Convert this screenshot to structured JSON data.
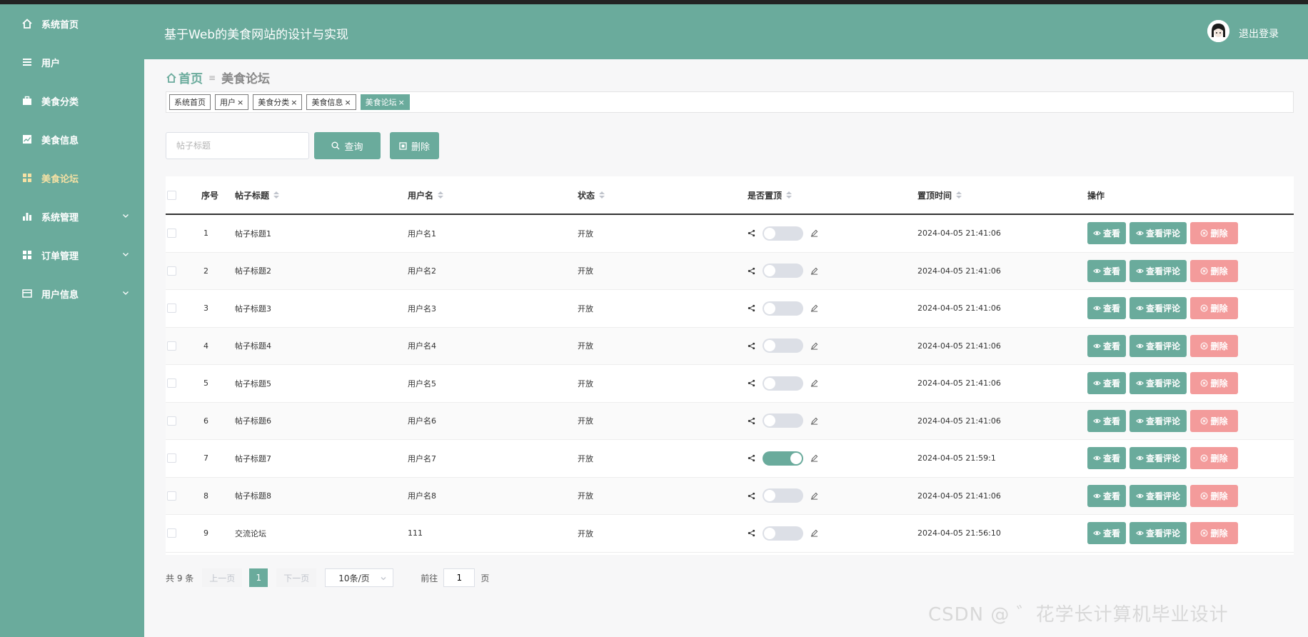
{
  "app_title": "基于Web的美食网站的设计与实现",
  "header": {
    "logout": "退出登录"
  },
  "sidebar": {
    "items": [
      {
        "label": "系统首页",
        "icon": "home-icon",
        "active": false,
        "expandable": false
      },
      {
        "label": "用户",
        "icon": "list-icon",
        "active": false,
        "expandable": false
      },
      {
        "label": "美食分类",
        "icon": "briefcase-icon",
        "active": false,
        "expandable": false
      },
      {
        "label": "美食信息",
        "icon": "chart-icon",
        "active": false,
        "expandable": false
      },
      {
        "label": "美食论坛",
        "icon": "grid-icon",
        "active": true,
        "expandable": false
      },
      {
        "label": "系统管理",
        "icon": "bar-chart-icon",
        "active": false,
        "expandable": true
      },
      {
        "label": "订单管理",
        "icon": "grid-icon",
        "active": false,
        "expandable": true
      },
      {
        "label": "用户信息",
        "icon": "card-icon",
        "active": false,
        "expandable": true
      }
    ]
  },
  "breadcrumb": {
    "home": "首页",
    "current": "美食论坛"
  },
  "tags": [
    {
      "label": "系统首页",
      "closable": false,
      "active": false
    },
    {
      "label": "用户",
      "closable": true,
      "active": false
    },
    {
      "label": "美食分类",
      "closable": true,
      "active": false
    },
    {
      "label": "美食信息",
      "closable": true,
      "active": false
    },
    {
      "label": "美食论坛",
      "closable": true,
      "active": true
    }
  ],
  "search": {
    "placeholder": "帖子标题",
    "value": "",
    "query_label": "查询",
    "delete_label": "删除"
  },
  "table": {
    "columns": {
      "index": "序号",
      "title": "帖子标题",
      "username": "用户名",
      "status": "状态",
      "pinned": "是否置顶",
      "pin_time": "置顶时间",
      "actions": "操作"
    },
    "actions": {
      "view": "查看",
      "comments": "查看评论",
      "delete": "删除"
    },
    "rows": [
      {
        "index": "1",
        "title": "帖子标题1",
        "username": "用户名1",
        "status": "开放",
        "pinned": false,
        "pin_time": "2024-04-05 21:41:06"
      },
      {
        "index": "2",
        "title": "帖子标题2",
        "username": "用户名2",
        "status": "开放",
        "pinned": false,
        "pin_time": "2024-04-05 21:41:06"
      },
      {
        "index": "3",
        "title": "帖子标题3",
        "username": "用户名3",
        "status": "开放",
        "pinned": false,
        "pin_time": "2024-04-05 21:41:06"
      },
      {
        "index": "4",
        "title": "帖子标题4",
        "username": "用户名4",
        "status": "开放",
        "pinned": false,
        "pin_time": "2024-04-05 21:41:06"
      },
      {
        "index": "5",
        "title": "帖子标题5",
        "username": "用户名5",
        "status": "开放",
        "pinned": false,
        "pin_time": "2024-04-05 21:41:06"
      },
      {
        "index": "6",
        "title": "帖子标题6",
        "username": "用户名6",
        "status": "开放",
        "pinned": false,
        "pin_time": "2024-04-05 21:41:06"
      },
      {
        "index": "7",
        "title": "帖子标题7",
        "username": "用户名7",
        "status": "开放",
        "pinned": true,
        "pin_time": "2024-04-05 21:59:1"
      },
      {
        "index": "8",
        "title": "帖子标题8",
        "username": "用户名8",
        "status": "开放",
        "pinned": false,
        "pin_time": "2024-04-05 21:41:06"
      },
      {
        "index": "9",
        "title": "交流论坛",
        "username": "111",
        "status": "开放",
        "pinned": false,
        "pin_time": "2024-04-05 21:56:10"
      }
    ]
  },
  "pagination": {
    "total": "共 9 条",
    "prev": "上一页",
    "page": "1",
    "next": "下一页",
    "page_size": "10条/页",
    "goto_label": "前往",
    "goto_value": "1",
    "page_unit": "页"
  },
  "watermark": "CSDN @ ゛花学长计算机毕业设计",
  "colors": {
    "theme": "#6aab9c",
    "danger": "#f39b9b",
    "active_menu": "#f5e1a4"
  }
}
